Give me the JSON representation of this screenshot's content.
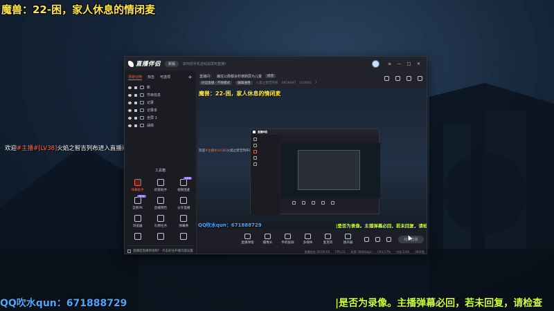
{
  "overlay": {
    "title": "魔兽：22-困，家人休息的情闭麦",
    "welcome_prefix": "欢迎",
    "welcome_tag": "#主播#[LV38]",
    "welcome_suffix": "火焰之智吉列布进入直播间",
    "qq": "QQ吹水qun：671888729",
    "ticker": "|是否为录像。主播弹幕必回，若未回复，请检查"
  },
  "app": {
    "name": "直播伴侣",
    "version_label": "新版",
    "title_hint": "如何把手机游戏投屏到直播？",
    "left_tabs": [
      "场景切换",
      "双击",
      "可选项"
    ],
    "add_symbol": "+",
    "sources": [
      "新",
      "节目信息",
      "记录",
      "记录本",
      "全屏 1",
      "战绩"
    ],
    "tools_title": "工具箱",
    "tools": [
      {
        "label": "弹幕助手",
        "icon": "danmaku-icon",
        "hot": true,
        "badge": ""
      },
      {
        "label": "房管助手",
        "icon": "user-icon",
        "hot": false,
        "badge": ""
      },
      {
        "label": "视频连麦",
        "icon": "video-call-icon",
        "hot": false,
        "badge": "NEW"
      },
      {
        "label": "全民PK",
        "icon": "pk-icon",
        "hot": false,
        "badge": "NEW"
      },
      {
        "label": "直播预告",
        "icon": "notice-icon",
        "hot": false,
        "badge": ""
      },
      {
        "label": "分享直播",
        "icon": "share-icon",
        "hot": false,
        "badge": ""
      },
      {
        "label": "浏览器",
        "icon": "browser-icon",
        "hot": false,
        "badge": ""
      },
      {
        "label": "礼物任务",
        "icon": "gift-icon",
        "hot": false,
        "badge": ""
      },
      {
        "label": "弹幕秀",
        "icon": "show-icon",
        "hot": false,
        "badge": ""
      },
      {
        "label": "",
        "icon": "more-icon",
        "hot": false,
        "badge": ""
      },
      {
        "label": "",
        "icon": "download-icon",
        "hot": false,
        "badge": ""
      },
      {
        "label": "",
        "icon": "home-icon",
        "hot": false,
        "badge": ""
      }
    ],
    "footer_text": "直播后直播到视频？ 点击前往开播页面设置",
    "info_line1": "直播间：",
    "info_line1_value": "魔狂公爵都会秒被刷屏为儿童",
    "info_line1_btn": "修改",
    "info_line2_a": "好运直播 · 不限模式",
    "info_line2_b": "编辑通用",
    "info_line2_c": "火焰之智吉列布",
    "info_line2_d": "6819497",
    "info_line2_e": "103910",
    "info_line2_f": "7",
    "controls": [
      "直播弹窗",
      "摄像头",
      "手机投屏",
      "多媒体",
      "麦克风",
      "扬声器"
    ],
    "go_live": "结束直播",
    "status_items": [
      "直播时长 00:00:00",
      "FPS:23",
      "码率 3840kbps",
      "CPU:17%",
      "内存:23%",
      "4K环境"
    ]
  },
  "preview": {
    "title": "魔兽：22-困，家人休息的情闭麦",
    "welcome_prefix": "欢迎",
    "welcome_tag": "#主播#[LV38]",
    "welcome_suffix": "火焰之智吉列布进入直播间",
    "qq": "QQ吹水qun：671888729",
    "ticker": "|是否为录像。主播弹幕必回，若未回复，请检查",
    "nested_name": "直播伴侣"
  }
}
